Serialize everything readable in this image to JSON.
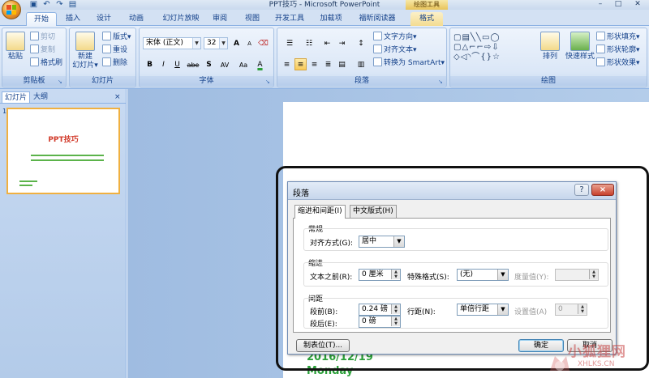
{
  "window": {
    "title": "PPT技巧 - Microsoft PowerPoint",
    "context_group": "绘图工具"
  },
  "ribbon_tabs": [
    {
      "label": "开始",
      "active": true
    },
    {
      "label": "插入"
    },
    {
      "label": "设计"
    },
    {
      "label": "动画"
    },
    {
      "label": "幻灯片放映"
    },
    {
      "label": "审阅"
    },
    {
      "label": "视图"
    },
    {
      "label": "开发工具"
    },
    {
      "label": "加载项"
    },
    {
      "label": "福昕阅读器"
    },
    {
      "label": "格式",
      "context": true
    }
  ],
  "clipboard": {
    "group_label": "剪贴板",
    "paste": "粘贴",
    "cut": "剪切",
    "copy": "复制",
    "format_painter": "格式刷"
  },
  "slides_group": {
    "group_label": "幻灯片",
    "new_slide_line1": "新建",
    "new_slide_line2": "幻灯片▾",
    "layout": "版式▾",
    "reset": "重设",
    "delete": "删除"
  },
  "font_group": {
    "group_label": "字体",
    "font_name": "宋体 (正文)",
    "font_size": "32",
    "bold": "B",
    "italic": "I",
    "underline": "U",
    "strike": "abe",
    "shadow": "S",
    "spacing": "AV",
    "case": "Aa",
    "color": "A",
    "grow": "A",
    "shrink": "A"
  },
  "paragraph_group": {
    "group_label": "段落",
    "text_direction": "文字方向▾",
    "align_text": "对齐文本▾",
    "smartart": "转换为 SmartArt▾"
  },
  "drawing_group": {
    "group_label": "绘图",
    "arrange": "排列",
    "quick_styles": "快速样式",
    "shape_fill": "形状填充▾",
    "shape_outline": "形状轮廓▾",
    "shape_effects": "形状效果▾"
  },
  "left_pane": {
    "tab_slides": "幻灯片",
    "tab_outline": "大纲",
    "close": "×",
    "thumb_number": "1",
    "thumb_title": "PPT技巧"
  },
  "slide": {
    "date": "2016/12/19",
    "day": "Monday"
  },
  "dialog": {
    "title": "段落",
    "help": "?",
    "close": "×",
    "tabs": [
      "缩进和间距(I)",
      "中文版式(H)"
    ],
    "general": {
      "section": "常规",
      "align_label": "对齐方式(G):",
      "align_value": "居中"
    },
    "indent": {
      "section": "缩进",
      "before_label": "文本之前(R):",
      "before_value": "0 厘米",
      "special_label": "特殊格式(S):",
      "special_value": "(无)",
      "by_label": "度量值(Y):",
      "by_value": ""
    },
    "spacing": {
      "section": "间距",
      "before_label": "段前(B):",
      "before_value": "0.24 磅",
      "after_label": "段后(E):",
      "after_value": "0 磅",
      "line_label": "行距(N):",
      "line_value": "单倍行距",
      "at_label": "设置值(A)",
      "at_value": "0"
    },
    "tabs_button": "制表位(T)...",
    "ok": "确定",
    "cancel": "取消"
  },
  "watermark": {
    "text": "小狐狸网",
    "sub": "XHLKS.CN"
  }
}
